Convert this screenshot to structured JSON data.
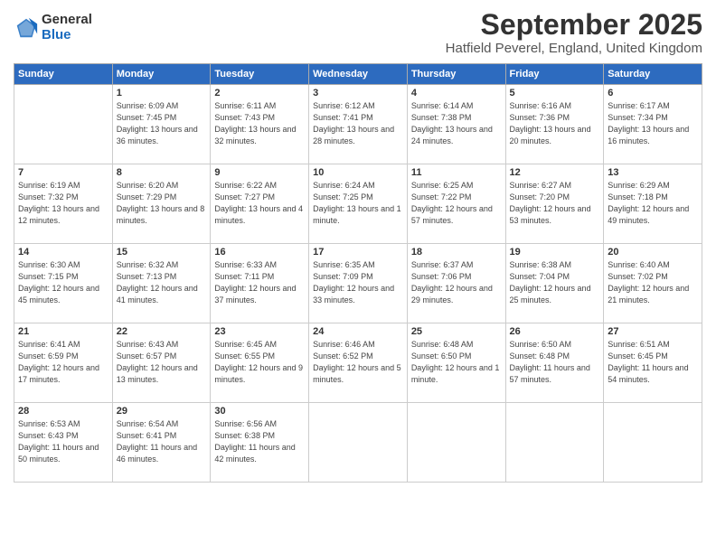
{
  "header": {
    "logo": {
      "general": "General",
      "blue": "Blue"
    },
    "title": "September 2025",
    "location": "Hatfield Peverel, England, United Kingdom"
  },
  "days": [
    "Sunday",
    "Monday",
    "Tuesday",
    "Wednesday",
    "Thursday",
    "Friday",
    "Saturday"
  ],
  "weeks": [
    [
      {
        "num": "",
        "sunrise": "",
        "sunset": "",
        "daylight": ""
      },
      {
        "num": "1",
        "sunrise": "Sunrise: 6:09 AM",
        "sunset": "Sunset: 7:45 PM",
        "daylight": "Daylight: 13 hours and 36 minutes."
      },
      {
        "num": "2",
        "sunrise": "Sunrise: 6:11 AM",
        "sunset": "Sunset: 7:43 PM",
        "daylight": "Daylight: 13 hours and 32 minutes."
      },
      {
        "num": "3",
        "sunrise": "Sunrise: 6:12 AM",
        "sunset": "Sunset: 7:41 PM",
        "daylight": "Daylight: 13 hours and 28 minutes."
      },
      {
        "num": "4",
        "sunrise": "Sunrise: 6:14 AM",
        "sunset": "Sunset: 7:38 PM",
        "daylight": "Daylight: 13 hours and 24 minutes."
      },
      {
        "num": "5",
        "sunrise": "Sunrise: 6:16 AM",
        "sunset": "Sunset: 7:36 PM",
        "daylight": "Daylight: 13 hours and 20 minutes."
      },
      {
        "num": "6",
        "sunrise": "Sunrise: 6:17 AM",
        "sunset": "Sunset: 7:34 PM",
        "daylight": "Daylight: 13 hours and 16 minutes."
      }
    ],
    [
      {
        "num": "7",
        "sunrise": "Sunrise: 6:19 AM",
        "sunset": "Sunset: 7:32 PM",
        "daylight": "Daylight: 13 hours and 12 minutes."
      },
      {
        "num": "8",
        "sunrise": "Sunrise: 6:20 AM",
        "sunset": "Sunset: 7:29 PM",
        "daylight": "Daylight: 13 hours and 8 minutes."
      },
      {
        "num": "9",
        "sunrise": "Sunrise: 6:22 AM",
        "sunset": "Sunset: 7:27 PM",
        "daylight": "Daylight: 13 hours and 4 minutes."
      },
      {
        "num": "10",
        "sunrise": "Sunrise: 6:24 AM",
        "sunset": "Sunset: 7:25 PM",
        "daylight": "Daylight: 13 hours and 1 minute."
      },
      {
        "num": "11",
        "sunrise": "Sunrise: 6:25 AM",
        "sunset": "Sunset: 7:22 PM",
        "daylight": "Daylight: 12 hours and 57 minutes."
      },
      {
        "num": "12",
        "sunrise": "Sunrise: 6:27 AM",
        "sunset": "Sunset: 7:20 PM",
        "daylight": "Daylight: 12 hours and 53 minutes."
      },
      {
        "num": "13",
        "sunrise": "Sunrise: 6:29 AM",
        "sunset": "Sunset: 7:18 PM",
        "daylight": "Daylight: 12 hours and 49 minutes."
      }
    ],
    [
      {
        "num": "14",
        "sunrise": "Sunrise: 6:30 AM",
        "sunset": "Sunset: 7:15 PM",
        "daylight": "Daylight: 12 hours and 45 minutes."
      },
      {
        "num": "15",
        "sunrise": "Sunrise: 6:32 AM",
        "sunset": "Sunset: 7:13 PM",
        "daylight": "Daylight: 12 hours and 41 minutes."
      },
      {
        "num": "16",
        "sunrise": "Sunrise: 6:33 AM",
        "sunset": "Sunset: 7:11 PM",
        "daylight": "Daylight: 12 hours and 37 minutes."
      },
      {
        "num": "17",
        "sunrise": "Sunrise: 6:35 AM",
        "sunset": "Sunset: 7:09 PM",
        "daylight": "Daylight: 12 hours and 33 minutes."
      },
      {
        "num": "18",
        "sunrise": "Sunrise: 6:37 AM",
        "sunset": "Sunset: 7:06 PM",
        "daylight": "Daylight: 12 hours and 29 minutes."
      },
      {
        "num": "19",
        "sunrise": "Sunrise: 6:38 AM",
        "sunset": "Sunset: 7:04 PM",
        "daylight": "Daylight: 12 hours and 25 minutes."
      },
      {
        "num": "20",
        "sunrise": "Sunrise: 6:40 AM",
        "sunset": "Sunset: 7:02 PM",
        "daylight": "Daylight: 12 hours and 21 minutes."
      }
    ],
    [
      {
        "num": "21",
        "sunrise": "Sunrise: 6:41 AM",
        "sunset": "Sunset: 6:59 PM",
        "daylight": "Daylight: 12 hours and 17 minutes."
      },
      {
        "num": "22",
        "sunrise": "Sunrise: 6:43 AM",
        "sunset": "Sunset: 6:57 PM",
        "daylight": "Daylight: 12 hours and 13 minutes."
      },
      {
        "num": "23",
        "sunrise": "Sunrise: 6:45 AM",
        "sunset": "Sunset: 6:55 PM",
        "daylight": "Daylight: 12 hours and 9 minutes."
      },
      {
        "num": "24",
        "sunrise": "Sunrise: 6:46 AM",
        "sunset": "Sunset: 6:52 PM",
        "daylight": "Daylight: 12 hours and 5 minutes."
      },
      {
        "num": "25",
        "sunrise": "Sunrise: 6:48 AM",
        "sunset": "Sunset: 6:50 PM",
        "daylight": "Daylight: 12 hours and 1 minute."
      },
      {
        "num": "26",
        "sunrise": "Sunrise: 6:50 AM",
        "sunset": "Sunset: 6:48 PM",
        "daylight": "Daylight: 11 hours and 57 minutes."
      },
      {
        "num": "27",
        "sunrise": "Sunrise: 6:51 AM",
        "sunset": "Sunset: 6:45 PM",
        "daylight": "Daylight: 11 hours and 54 minutes."
      }
    ],
    [
      {
        "num": "28",
        "sunrise": "Sunrise: 6:53 AM",
        "sunset": "Sunset: 6:43 PM",
        "daylight": "Daylight: 11 hours and 50 minutes."
      },
      {
        "num": "29",
        "sunrise": "Sunrise: 6:54 AM",
        "sunset": "Sunset: 6:41 PM",
        "daylight": "Daylight: 11 hours and 46 minutes."
      },
      {
        "num": "30",
        "sunrise": "Sunrise: 6:56 AM",
        "sunset": "Sunset: 6:38 PM",
        "daylight": "Daylight: 11 hours and 42 minutes."
      },
      {
        "num": "",
        "sunrise": "",
        "sunset": "",
        "daylight": ""
      },
      {
        "num": "",
        "sunrise": "",
        "sunset": "",
        "daylight": ""
      },
      {
        "num": "",
        "sunrise": "",
        "sunset": "",
        "daylight": ""
      },
      {
        "num": "",
        "sunrise": "",
        "sunset": "",
        "daylight": ""
      }
    ]
  ]
}
